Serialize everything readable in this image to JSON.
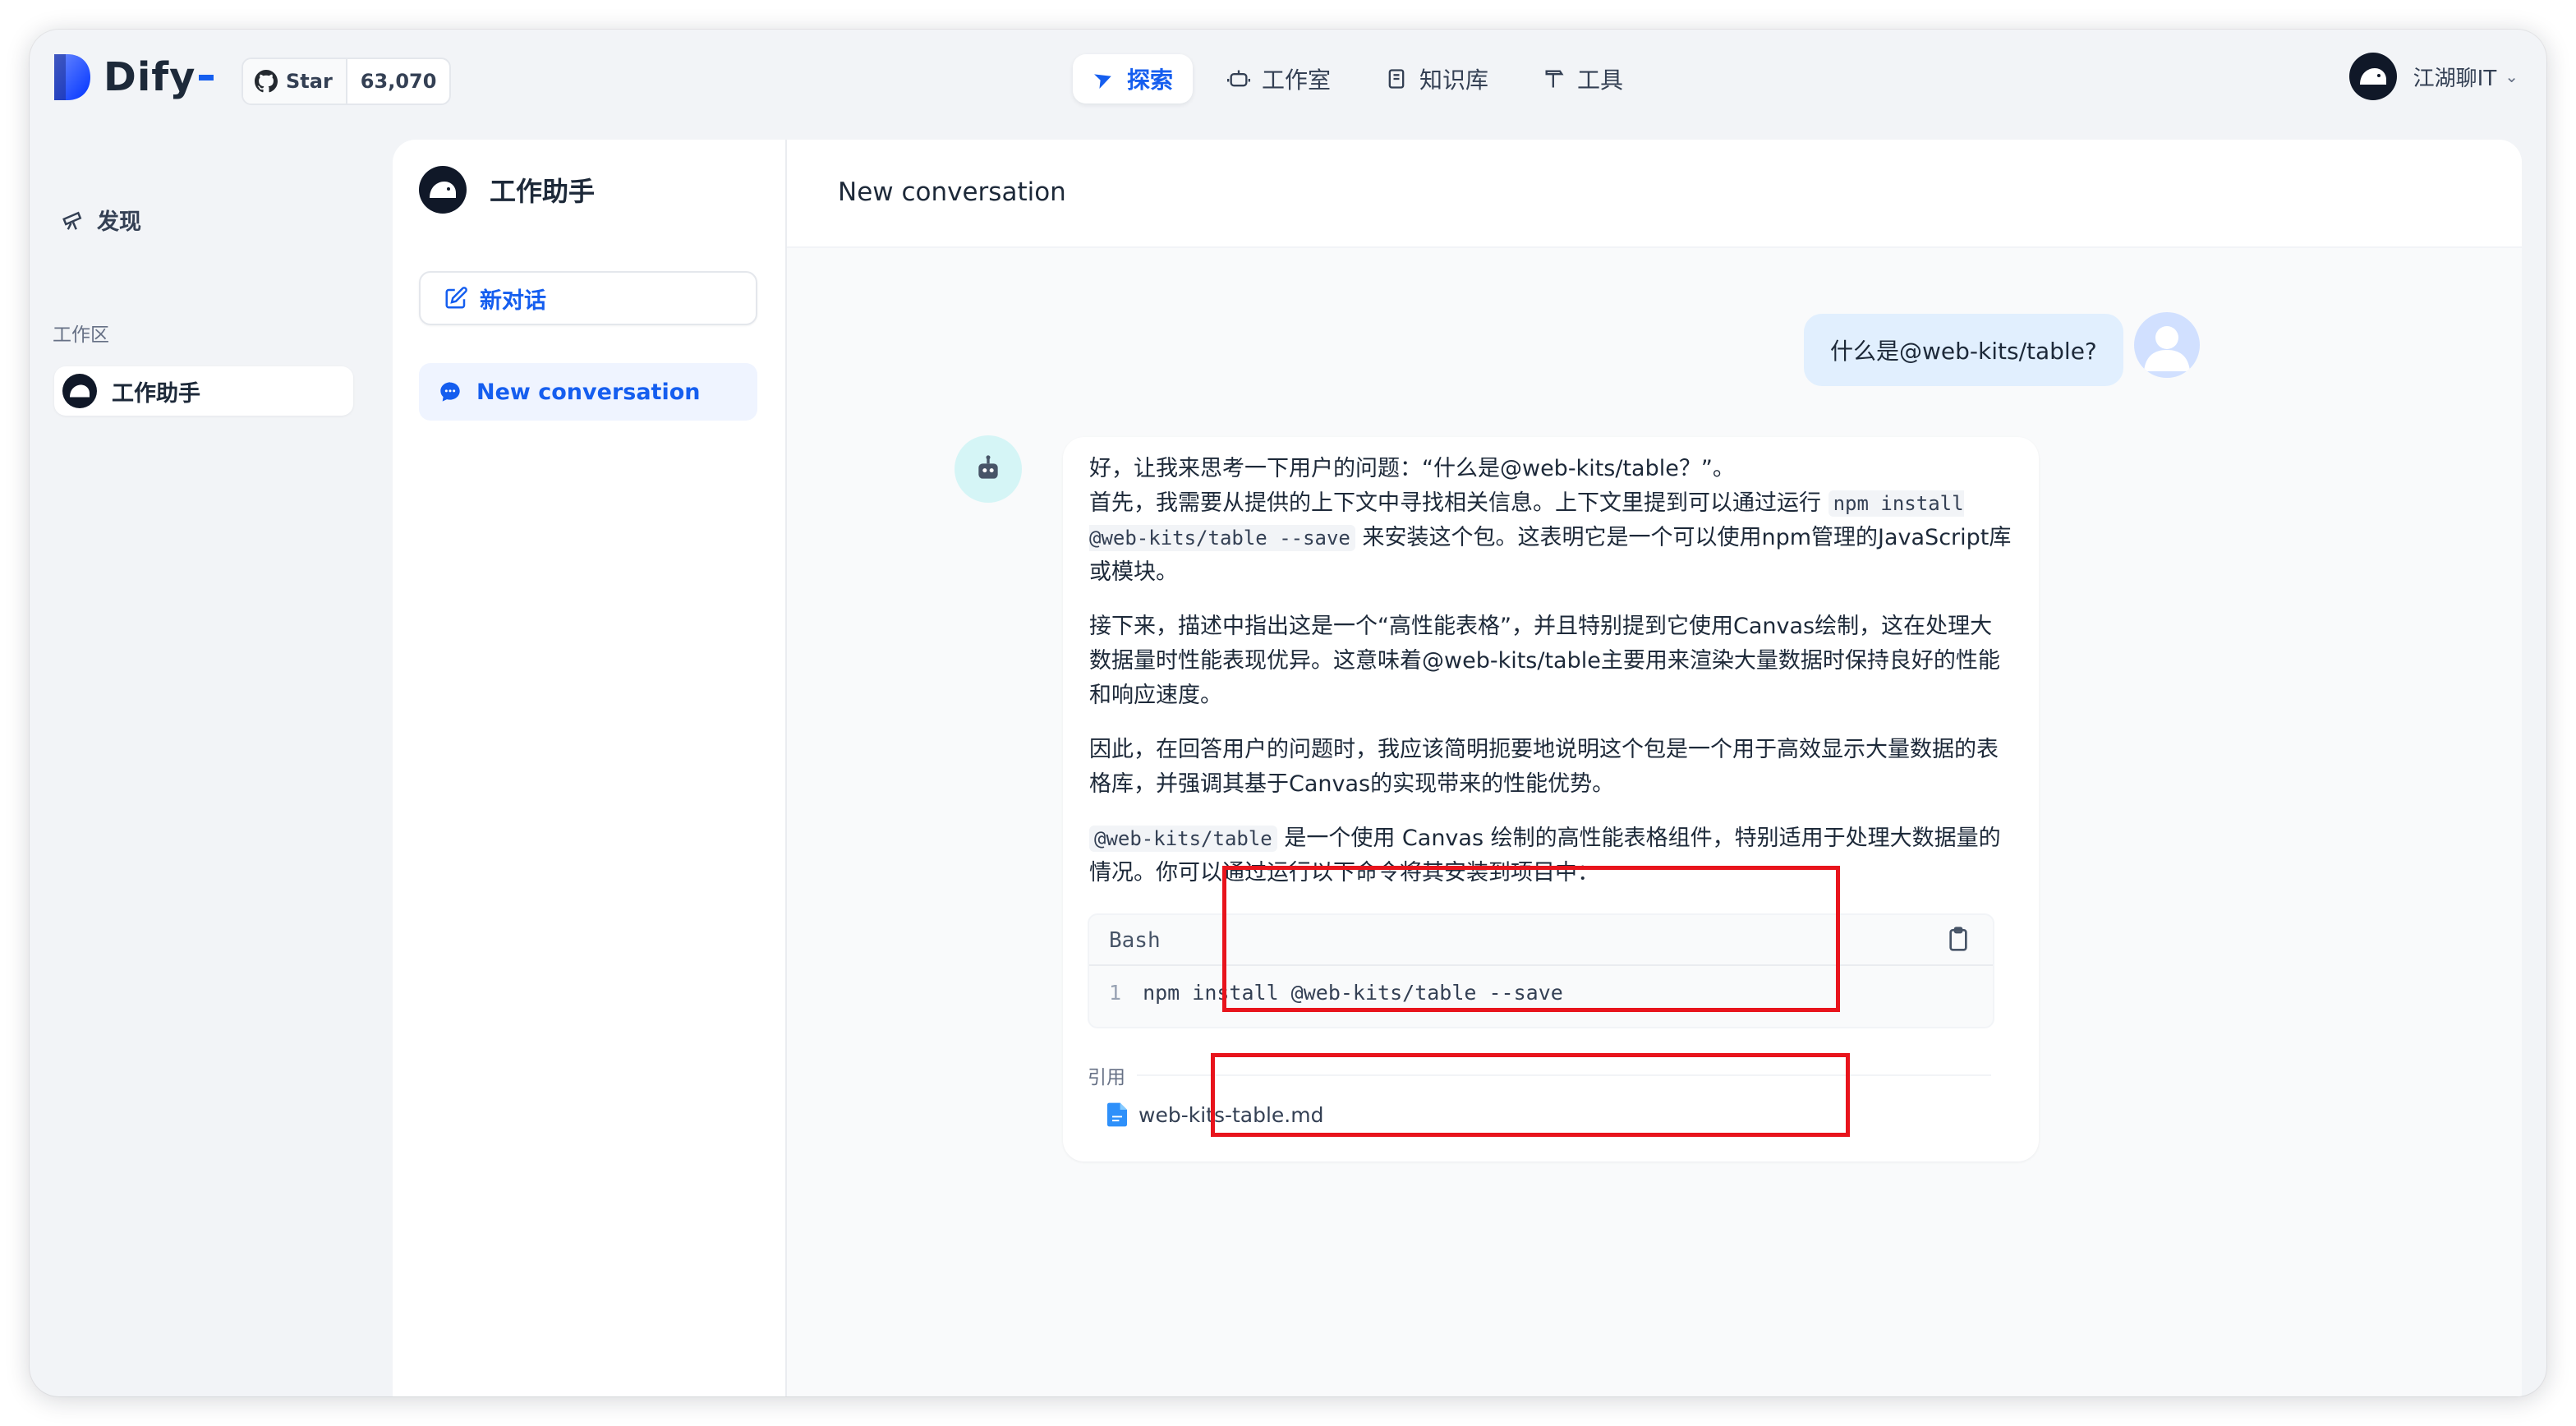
{
  "brand": {
    "name": "Dify",
    "brand_color": "#155eef"
  },
  "github": {
    "star_label": "Star",
    "star_count": "63,070",
    "icon": "github-icon"
  },
  "nav": {
    "items": [
      {
        "label": "探索",
        "icon": "compass-icon",
        "active": true
      },
      {
        "label": "工作室",
        "icon": "robot-icon",
        "active": false
      },
      {
        "label": "知识库",
        "icon": "book-icon",
        "active": false
      },
      {
        "label": "工具",
        "icon": "hammer-icon",
        "active": false
      }
    ]
  },
  "user": {
    "name": "江湖聊IT",
    "avatar": "whale-avatar"
  },
  "sidebar": {
    "discover_label": "发现",
    "workspace_label": "工作区",
    "apps": [
      {
        "label": "工作助手",
        "avatar": "whale-avatar"
      }
    ]
  },
  "app": {
    "name": "工作助手",
    "new_chat_label": "新对话",
    "conversations": [
      {
        "label": "New conversation",
        "active": true
      }
    ]
  },
  "chat": {
    "title": "New conversation",
    "user_message": "什么是@web-kits/table?",
    "answer": {
      "p1_line1": "好，让我来思考一下用户的问题：“什么是@web-kits/table？”。",
      "p1_line2_pre": "首先，我需要从提供的上下文中寻找相关信息。上下文里提到可以通过运行 ",
      "p1_code": "npm install @web-kits/table --save",
      "p1_line2_post": " 来安装这个包。这表明它是一个可以使用npm管理的JavaScript库或模块。",
      "p2": "接下来，描述中指出这是一个“高性能表格”，并且特别提到它使用Canvas绘制，这在处理大数据量时性能表现优异。这意味着@web-kits/table主要用来渲染大量数据时保持良好的性能和响应速度。",
      "p3": "因此，在回答用户的问题时，我应该简明扼要地说明这个包是一个用于高效显示大量数据的表格库，并强调其基于Canvas的实现带来的性能优势。",
      "p4_code": "@web-kits/table",
      "p4_text": " 是一个使用 Canvas 绘制的高性能表格组件，特别适用于处理大数据量的情况。你可以通过运行以下命令将其安装到项目中："
    },
    "code_block": {
      "language": "Bash",
      "line_number": "1",
      "code": "npm install @web-kits/table --save",
      "copy_icon": "clipboard-icon"
    },
    "citation": {
      "label": "引用",
      "file": "web-kits-table.md",
      "file_icon": "markdown-file-icon"
    }
  },
  "annotation_color": "#e8141c"
}
